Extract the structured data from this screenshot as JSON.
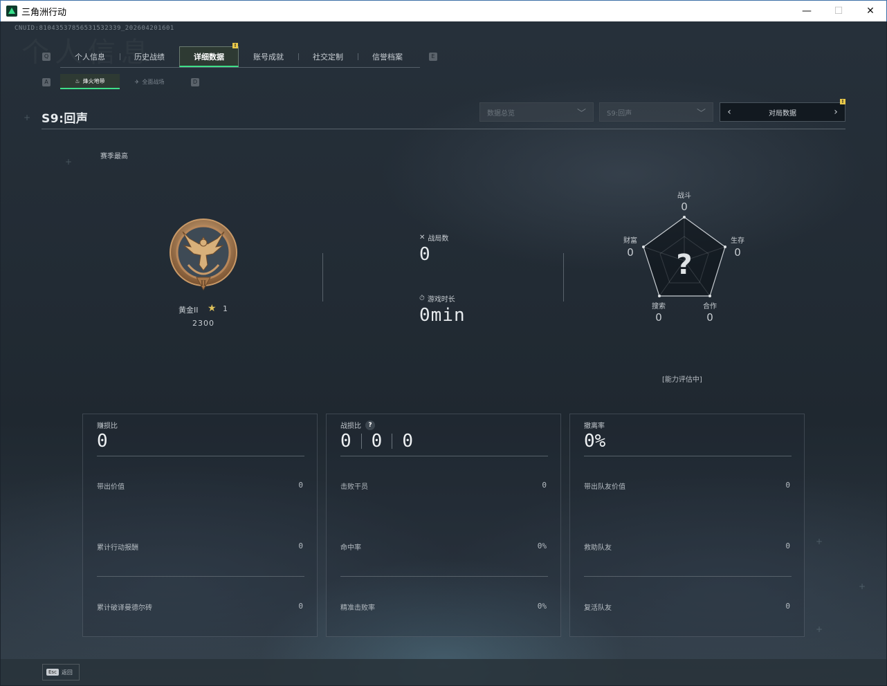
{
  "window": {
    "title": "三角洲行动",
    "minimize": "—",
    "maximize": "☐",
    "close": "✕"
  },
  "uid": "CNUID:8104353785653153233​9_2026042016​01",
  "watermark": "个人信息",
  "main_tabs": [
    {
      "label": "个人信息",
      "key": "Q"
    },
    {
      "label": "历史战绩"
    },
    {
      "label": "详细数据",
      "active": true,
      "badge": "!"
    },
    {
      "label": "账号成就"
    },
    {
      "label": "社交定制"
    },
    {
      "label": "信誉档案"
    }
  ],
  "main_tabs_keys": {
    "left": "Q",
    "right": "E"
  },
  "sub_tabs": [
    {
      "label": "烽火地带",
      "active": true
    },
    {
      "label": "全面战场"
    }
  ],
  "sub_tabs_keys": {
    "left": "A",
    "right": "D"
  },
  "season_title": "S9:回声",
  "dropdowns": [
    {
      "value": "数据总览"
    },
    {
      "value": "S9:回声"
    }
  ],
  "pager": {
    "label": "对局数据",
    "badge": "!"
  },
  "season_best": "赛季最高",
  "rank": {
    "name": "黄金II",
    "stars": "1",
    "score": "2300",
    "tier_numeral": "II",
    "colors": {
      "bronze": "#a7774a",
      "highlight": "#e0b98a"
    }
  },
  "center_stats": {
    "matches_label": "战局数",
    "matches_value": "0",
    "playtime_label": "游戏时长",
    "playtime_value": "0min"
  },
  "radar": {
    "center_symbol": "?",
    "axes": [
      {
        "label": "战斗",
        "value": "0"
      },
      {
        "label": "生存",
        "value": "0"
      },
      {
        "label": "合作",
        "value": "0"
      },
      {
        "label": "搜索",
        "value": "0"
      },
      {
        "label": "财富",
        "value": "0"
      }
    ],
    "status": "[能力评估中]"
  },
  "panels": [
    {
      "title": "赚损比",
      "big_values": [
        "0"
      ],
      "rows": [
        {
          "label": "带出价值",
          "value": "0"
        },
        {
          "label": "累计行动报酬",
          "value": "0"
        },
        {
          "label": "累计破译曼德尔砖",
          "value": "0"
        }
      ]
    },
    {
      "title": "战损比",
      "help": "?",
      "big_values": [
        "0",
        "0",
        "0"
      ],
      "rows": [
        {
          "label": "击败干员",
          "value": "0"
        },
        {
          "label": "命中率",
          "value": "0%"
        },
        {
          "label": "精准击败率",
          "value": "0%"
        }
      ]
    },
    {
      "title": "撤离率",
      "big_values": [
        "0%"
      ],
      "rows": [
        {
          "label": "带出队友价值",
          "value": "0"
        },
        {
          "label": "救助队友",
          "value": "0"
        },
        {
          "label": "复活队友",
          "value": "0"
        }
      ]
    }
  ],
  "footer": {
    "key": "Esc",
    "label": "返回"
  },
  "accent_colors": {
    "green": "#3fe089",
    "gold": "#e8c84a"
  }
}
